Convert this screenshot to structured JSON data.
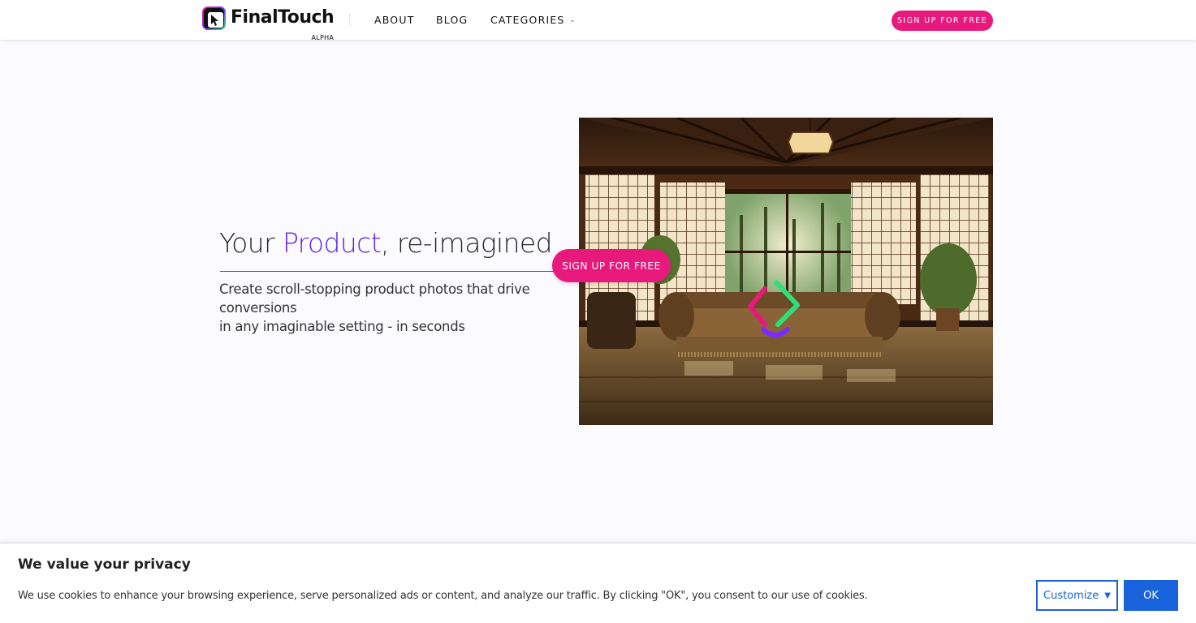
{
  "header": {
    "logo_text": "FinalTouch",
    "logo_sub": "ALPHA",
    "nav": {
      "about": "ABOUT",
      "blog": "BLOG",
      "categories": "CATEGORIES"
    },
    "cta_label": "SIGN UP FOR FREE"
  },
  "hero": {
    "title_before": "Your ",
    "title_accent": "Product",
    "title_after": ", re-imagined",
    "subtitle_line1": "Create scroll-stopping product photos that drive conversions",
    "subtitle_line2": "in any imaginable setting - in seconds",
    "cta_label": "SIGN UP FOR FREE",
    "image_alt": "sofa in a japanese room"
  },
  "cookie": {
    "title": "We value your privacy",
    "text": "We use cookies to enhance your browsing experience, serve personalized ads or content, and analyze our traffic. By clicking \"OK\", you consent to our use of cookies.",
    "customize_label": "Customize",
    "ok_label": "OK"
  },
  "colors": {
    "accent_pink": "#e8197d",
    "accent_purple": "#6226e4",
    "cookie_blue": "#1863dc",
    "background": "#fbfaff"
  },
  "icons": {
    "logo": "finaltouch-logo-icon",
    "chevron": "chevron-down-icon",
    "customize_caret": "caret-down-icon",
    "loader": "loading-spinner-icon"
  }
}
